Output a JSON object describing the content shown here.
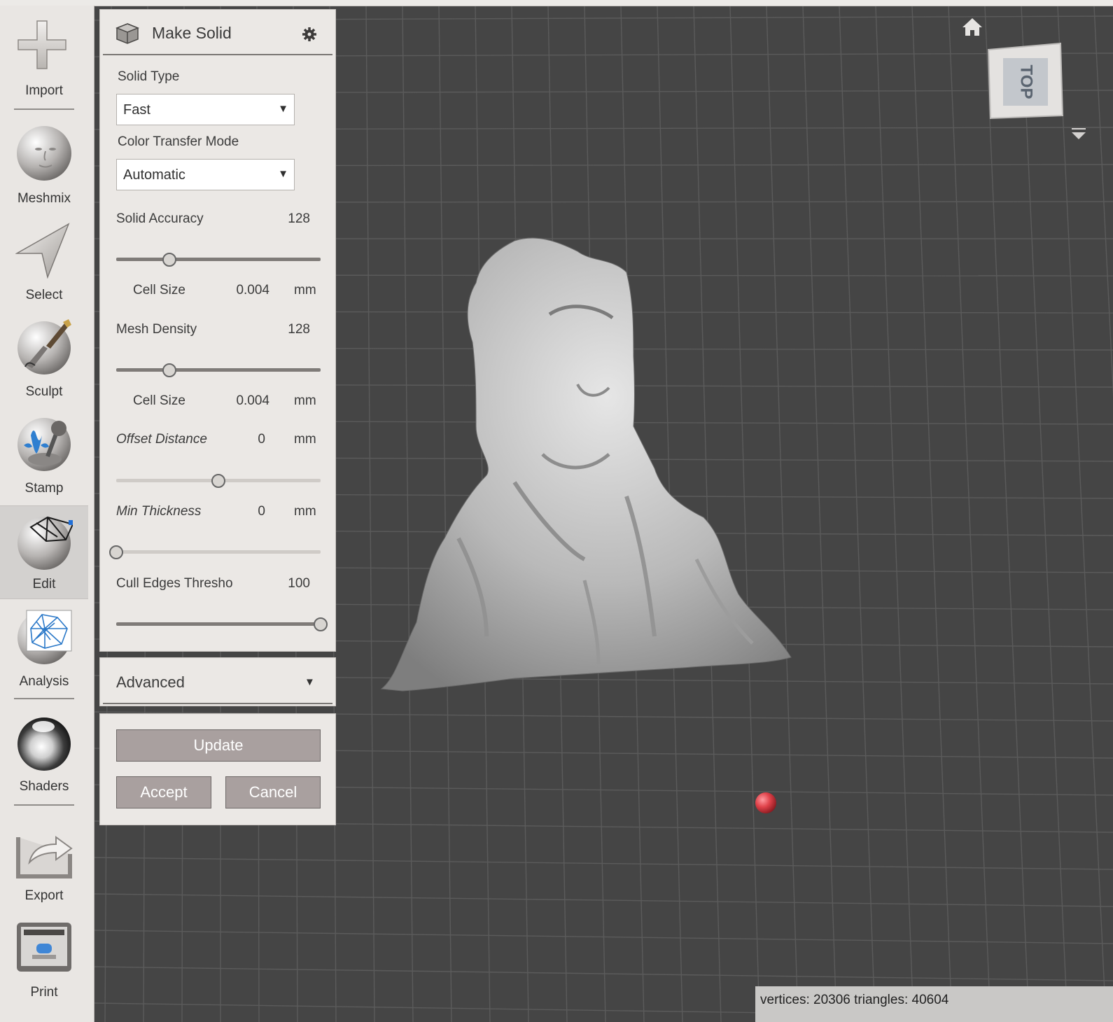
{
  "toolbar": {
    "items": [
      {
        "label": "Import",
        "icon": "plus-icon"
      },
      {
        "label": "Meshmix",
        "icon": "face-sphere-icon"
      },
      {
        "label": "Select",
        "icon": "arrow-pointer-icon"
      },
      {
        "label": "Sculpt",
        "icon": "brush-sphere-icon"
      },
      {
        "label": "Stamp",
        "icon": "stamp-sphere-icon"
      },
      {
        "label": "Edit",
        "icon": "wireframe-sphere-icon",
        "active": true
      },
      {
        "label": "Analysis",
        "icon": "mesh-sphere-icon"
      },
      {
        "label": "Shaders",
        "icon": "chrome-sphere-icon"
      },
      {
        "label": "Export",
        "icon": "export-box-icon"
      },
      {
        "label": "Print",
        "icon": "printer-icon"
      }
    ]
  },
  "panel": {
    "title": "Make Solid",
    "solid_type": {
      "label": "Solid Type",
      "value": "Fast"
    },
    "color_transfer": {
      "label": "Color Transfer Mode",
      "value": "Automatic"
    },
    "solid_accuracy": {
      "label": "Solid Accuracy",
      "value": "128",
      "level": 0.26
    },
    "cell_size_1": {
      "label": "Cell Size",
      "value": "0.004",
      "unit": "mm"
    },
    "mesh_density": {
      "label": "Mesh Density",
      "value": "128",
      "level": 0.26
    },
    "cell_size_2": {
      "label": "Cell Size",
      "value": "0.004",
      "unit": "mm"
    },
    "offset_distance": {
      "label": "Offset Distance",
      "value": "0",
      "unit": "mm",
      "level": 0.5
    },
    "min_thickness": {
      "label": "Min Thickness",
      "value": "0",
      "unit": "mm",
      "level": 0.0
    },
    "cull_edges": {
      "label": "Cull Edges Thresho",
      "value": "100",
      "level": 1.0
    }
  },
  "advanced": {
    "label": "Advanced"
  },
  "actions": {
    "update": "Update",
    "accept": "Accept",
    "cancel": "Cancel"
  },
  "viewcube": {
    "label": "TOP"
  },
  "status": {
    "text": "vertices: 20306 triangles: 40604"
  },
  "colors": {
    "viewport_bg": "#454545",
    "grid": "#5a5a5a",
    "panel_bg": "#ebe8e5",
    "button": "#a9a09f",
    "pivot": "#e0424a"
  }
}
